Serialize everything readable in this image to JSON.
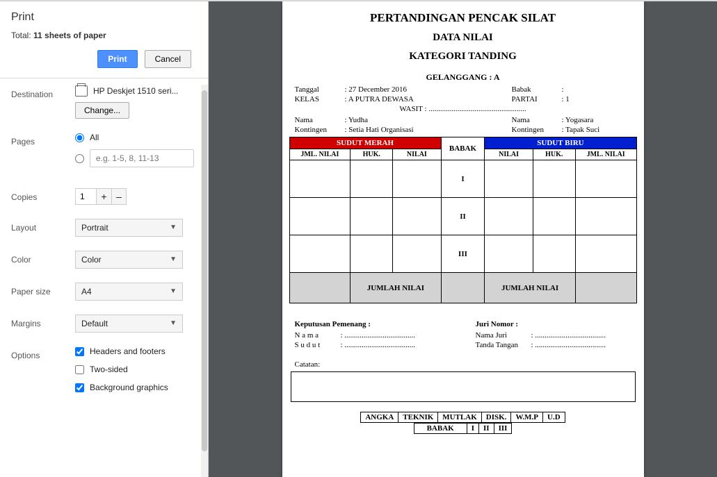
{
  "print": {
    "title": "Print",
    "total_prefix": "Total: ",
    "total_value": "11 sheets of paper",
    "btn_print": "Print",
    "btn_cancel": "Cancel",
    "destination_label": "Destination",
    "printer": "HP Deskjet 1510 seri...",
    "change_btn": "Change...",
    "pages_label": "Pages",
    "pages_all": "All",
    "pages_placeholder": "e.g. 1-5, 8, 11-13",
    "copies_label": "Copies",
    "copies_value": "1",
    "layout_label": "Layout",
    "layout_value": "Portrait",
    "color_label": "Color",
    "color_value": "Color",
    "papersize_label": "Paper size",
    "papersize_value": "A4",
    "margins_label": "Margins",
    "margins_value": "Default",
    "options_label": "Options",
    "opt1": "Headers and footers",
    "opt2": "Two-sided",
    "opt3": "Background graphics"
  },
  "doc": {
    "title1": "PERTANDINGAN PENCAK SILAT",
    "title2": "DATA NILAI",
    "title3": "KATEGORI TANDING",
    "gelanggang": "GELANGGANG : A",
    "meta": {
      "tanggal_l": "Tanggal",
      "tanggal_v": ": 27 December 2016",
      "babak_l": "Babak",
      "babak_v": ":",
      "kelas_l": "KELAS",
      "kelas_v": ": A PUTRA DEWASA",
      "partai_l": "PARTAI",
      "partai_v": ": 1",
      "wasit": "WASIT : ...................................................",
      "nama1_l": "Nama",
      "nama1_v": ": Yudha",
      "nama2_l": "Nama",
      "nama2_v": ": Yogasara",
      "kont1_l": "Kontingen",
      "kont1_v": ": Setia Hati Organisasi",
      "kont2_l": "Kontingen",
      "kont2_v": ": Tapak Suci"
    },
    "table": {
      "red": "SUDUT MERAH",
      "mid": "BABAK",
      "blue": "SUDUT BIRU",
      "cols_left": [
        "JML. NILAI",
        "HUK.",
        "NILAI"
      ],
      "cols_right": [
        "NILAI",
        "HUK.",
        "JML. NILAI"
      ],
      "rounds": [
        "I",
        "II",
        "III"
      ],
      "sum": "JUMLAH NILAI"
    },
    "footer": {
      "left_hdr": "Keputusan Pemenang :",
      "left_rows": [
        {
          "k": "N a m a",
          "v": ": ....................................."
        },
        {
          "k": "S u d u t",
          "v": ": ....................................."
        }
      ],
      "right_hdr": "Juri Nomor :",
      "right_rows": [
        {
          "k": "Nama Juri",
          "v": ": ....................................."
        },
        {
          "k": "Tanda Tangan",
          "v": ": ....................................."
        }
      ],
      "catatan": "Catatan:"
    },
    "bottom1": [
      "ANGKA",
      "TEKNIK",
      "MUTLAK",
      "DISK.",
      "W.M.P",
      "U.D"
    ],
    "bottom2": [
      "BABAK",
      "I",
      "II",
      "III"
    ]
  }
}
